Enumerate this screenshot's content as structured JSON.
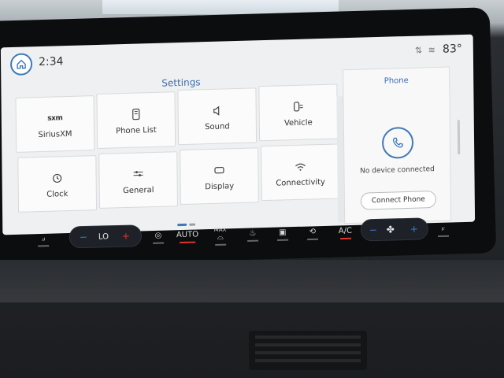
{
  "topbar": {
    "time": "2:34",
    "temperature": "83°",
    "status_icons": [
      "signal-icon",
      "wifi-icon"
    ]
  },
  "settings": {
    "title": "Settings",
    "tiles": [
      {
        "label": "SiriusXM",
        "icon": "siriusxm-icon",
        "badge": "sxm"
      },
      {
        "label": "Phone List",
        "icon": "phone-list-icon"
      },
      {
        "label": "Sound",
        "icon": "speaker-icon"
      },
      {
        "label": "Vehicle",
        "icon": "vehicle-icon"
      },
      {
        "label": "Clock",
        "icon": "clock-icon"
      },
      {
        "label": "General",
        "icon": "sliders-icon"
      },
      {
        "label": "Display",
        "icon": "display-icon"
      },
      {
        "label": "Connectivity",
        "icon": "wifi-icon"
      }
    ]
  },
  "phone": {
    "title": "Phone",
    "status": "No device connected",
    "connect_label": "Connect Phone"
  },
  "climate": {
    "fan_level": "LO",
    "auto_label": "AUTO",
    "max_label": "MAX",
    "ac_label": "A/C",
    "minus": "−",
    "plus": "+"
  },
  "colors": {
    "accent": "#3e78b8",
    "screen_bg": "#eef0f1",
    "tile_bg": "#fbfbfb",
    "red": "#e3342f",
    "blue": "#3a7bd5"
  }
}
